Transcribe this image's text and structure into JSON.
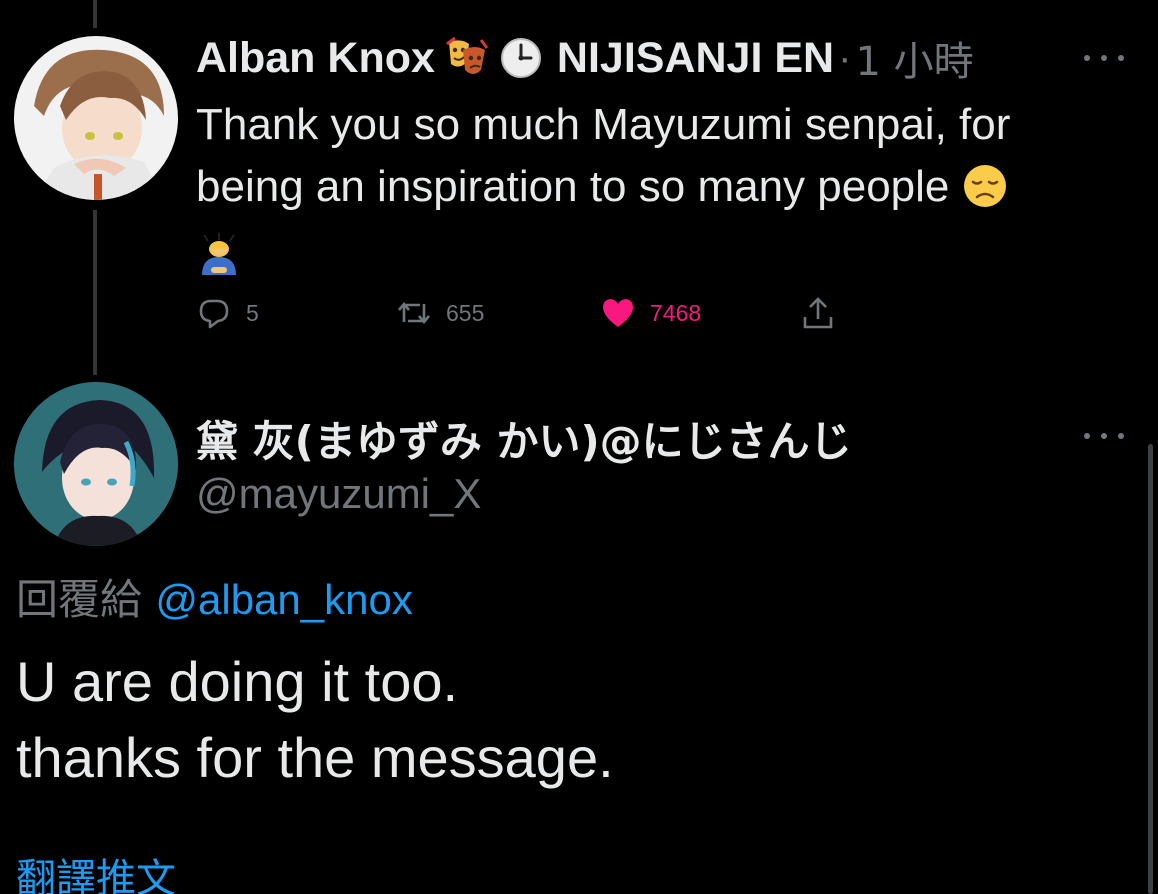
{
  "tweet1": {
    "display_name": "Alban Knox",
    "badge_icons": [
      "performing-arts-emoji",
      "clock-emoji"
    ],
    "affiliation": "NIJISANJI EN",
    "separator": "·",
    "time": "1 小時",
    "text": "Thank you so much Mayuzumi senpai, for being an inspiration to so many people",
    "emojis": [
      "disappointed-face-emoji",
      "person-bowing-emoji"
    ],
    "actions": {
      "reply_count": "5",
      "retweet_count": "655",
      "like_count": "7468",
      "share_icon": "share-icon"
    }
  },
  "tweet2": {
    "display_name": "黛 灰(まゆずみ かい)@にじさんじ",
    "handle": "@mayuzumi_X",
    "reply_prefix": "回覆給",
    "reply_to": "@alban_knox",
    "text_line1": "U are doing it too.",
    "text_line2": "thanks for the message.",
    "translate_label": "翻譯推文"
  },
  "colors": {
    "background": "#000000",
    "text_primary": "#e7e9ea",
    "text_secondary": "#71767b",
    "link": "#1d9bf0",
    "like": "#f91880"
  }
}
